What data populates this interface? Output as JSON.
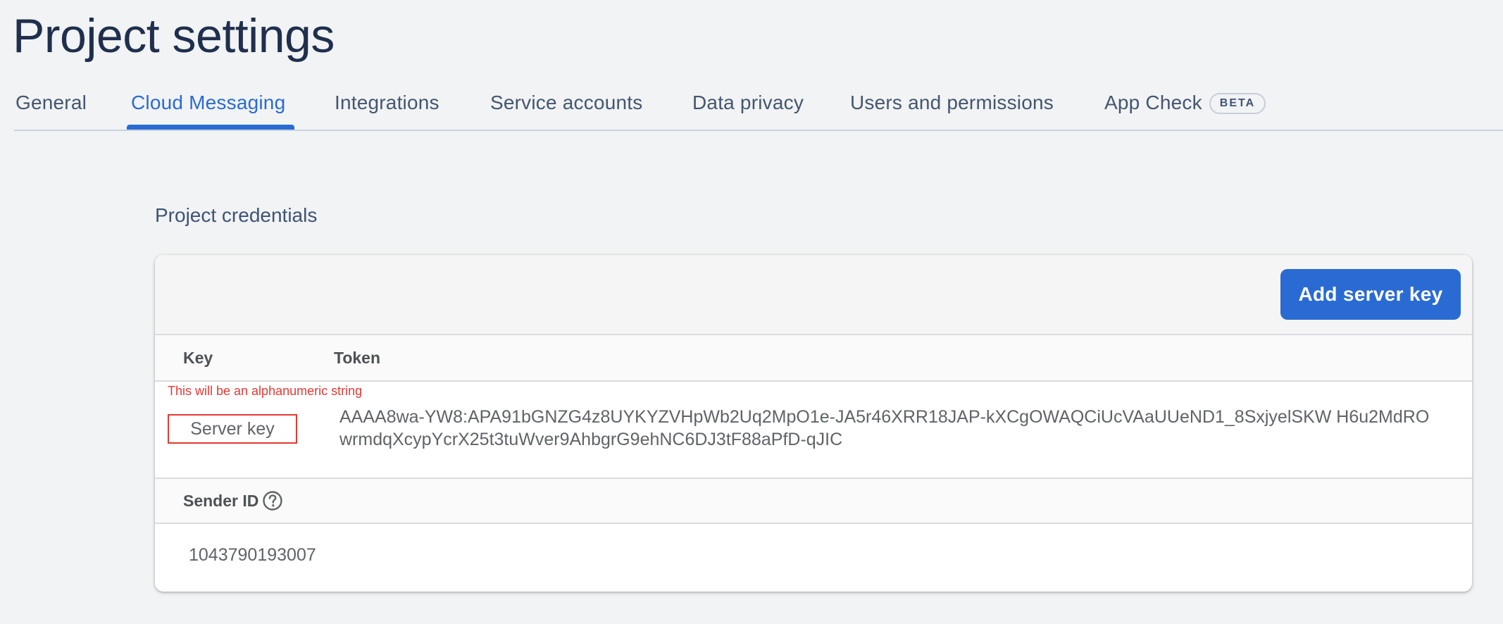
{
  "page": {
    "title": "Project settings"
  },
  "tabs": [
    {
      "label": "General"
    },
    {
      "label": "Cloud Messaging",
      "active": true
    },
    {
      "label": "Integrations"
    },
    {
      "label": "Service accounts"
    },
    {
      "label": "Data privacy"
    },
    {
      "label": "Users and permissions"
    },
    {
      "label": "App Check",
      "badge": "BETA"
    }
  ],
  "credentials": {
    "section_title": "Project credentials",
    "add_button_label": "Add server key",
    "columns": {
      "key": "Key",
      "token": "Token"
    },
    "server_key": {
      "hint": "This will be an alphanumeric string",
      "key_label": "Server key",
      "token": "AAAA8wa-YW8:APA91bGNZG4z8UYKYZVHpWb2Uq2MpO1e-JA5r46XRR18JAP-kXCgOWAQCiUcVAaUUeND1_8SxjyelSKW H6u2MdROwrmdqXcypYcrX25t3tuWver9AhbgrG9ehNC6DJ3tF88aPfD-qJIC"
    },
    "sender": {
      "label": "Sender ID",
      "help_icon": "help-circle-icon",
      "value": "1043790193007"
    }
  },
  "colors": {
    "accent": "#2a6bd3",
    "title": "#1f2f4d",
    "hint_red": "#e53935"
  }
}
